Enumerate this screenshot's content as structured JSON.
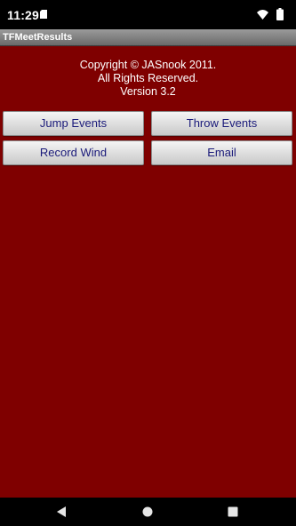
{
  "status_bar": {
    "time": "11:29",
    "icons": [
      "sd-card-icon",
      "wifi-icon",
      "battery-icon"
    ]
  },
  "app": {
    "title": "TFMeetResults"
  },
  "copyright": {
    "line1": "Copyright © JASnook 2011.",
    "line2": "All Rights Reserved.",
    "line3": "Version 3.2"
  },
  "buttons": {
    "jump_events": "Jump Events",
    "throw_events": "Throw Events",
    "record_wind": "Record Wind",
    "email": "Email"
  },
  "nav_bar": {
    "icons": [
      "back-icon",
      "home-icon",
      "recents-icon"
    ]
  },
  "colors": {
    "background": "#7f0000",
    "button_text": "#1a1a7a",
    "title_bar": "#808080"
  }
}
